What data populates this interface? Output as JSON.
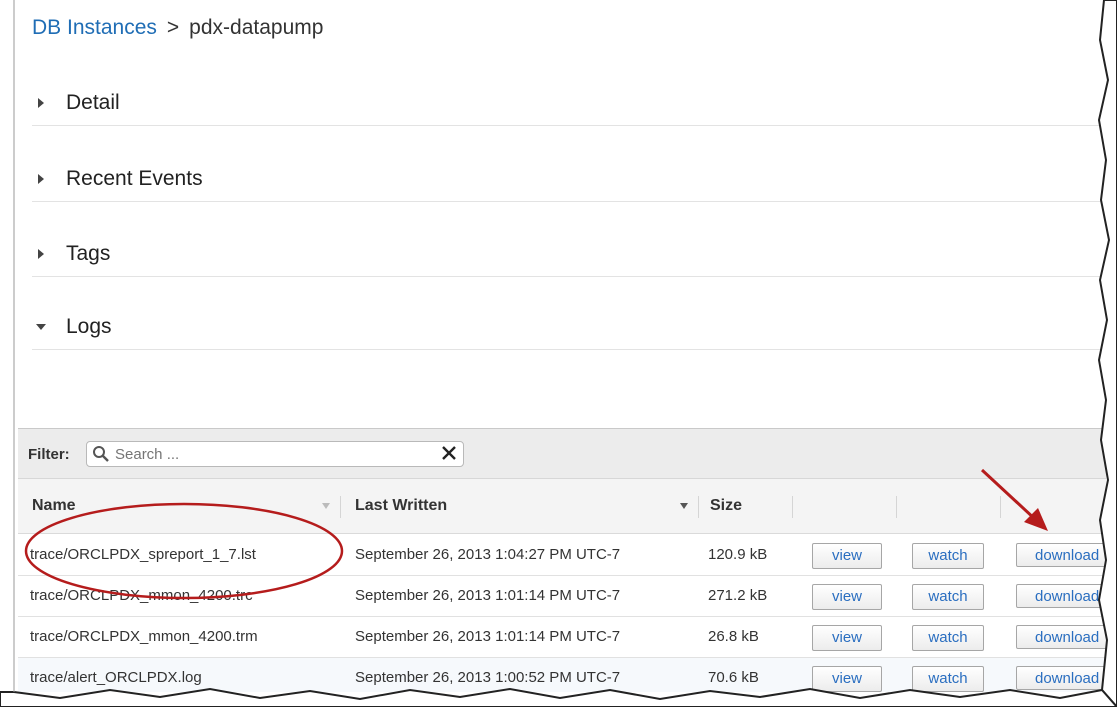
{
  "breadcrumb": {
    "parent": "DB Instances",
    "separator": ">",
    "current": "pdx-datapump"
  },
  "sections": [
    {
      "label": "Detail",
      "expanded": false
    },
    {
      "label": "Recent Events",
      "expanded": false
    },
    {
      "label": "Tags",
      "expanded": false
    },
    {
      "label": "Logs",
      "expanded": true
    }
  ],
  "logs": {
    "filter_label": "Filter:",
    "search": {
      "placeholder": "Search ...",
      "value": ""
    },
    "columns": {
      "name": "Name",
      "last_written": "Last Written",
      "size": "Size"
    },
    "actions": {
      "view": "view",
      "watch": "watch",
      "download": "download"
    },
    "rows": [
      {
        "name": "trace/ORCLPDX_spreport_1_7.lst",
        "last_written": "September 26, 2013 1:04:27 PM UTC-7",
        "size": "120.9 kB"
      },
      {
        "name": "trace/ORCLPDX_mmon_4200.trc",
        "last_written": "September 26, 2013 1:01:14 PM UTC-7",
        "size": "271.2 kB"
      },
      {
        "name": "trace/ORCLPDX_mmon_4200.trm",
        "last_written": "September 26, 2013 1:01:14 PM UTC-7",
        "size": "26.8 kB"
      },
      {
        "name": "trace/alert_ORCLPDX.log",
        "last_written": "September 26, 2013 1:00:52 PM UTC-7",
        "size": "70.6 kB"
      }
    ]
  },
  "colors": {
    "link": "#1f6db5",
    "annotation": "#b51c1c",
    "header_bg": "#f4f4f4",
    "filter_bg": "#ececec"
  },
  "icons": {
    "collapsed": "triangle-right-icon",
    "expanded": "triangle-down-icon",
    "search": "search-icon",
    "clear": "close-icon",
    "sort": "sort-down-icon"
  }
}
